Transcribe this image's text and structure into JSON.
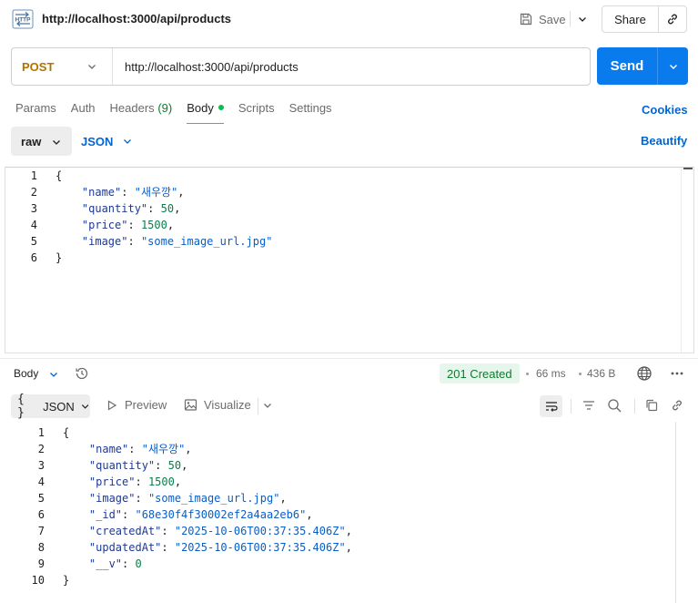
{
  "header": {
    "icon": "http-icon",
    "title": "http://localhost:3000/api/products",
    "save_label": "Save",
    "share_label": "Share"
  },
  "request": {
    "method": "POST",
    "url": "http://localhost:3000/api/products",
    "send_label": "Send"
  },
  "tabs": [
    {
      "label": "Params"
    },
    {
      "label": "Auth"
    },
    {
      "label": "Headers",
      "count": "(9)"
    },
    {
      "label": "Body",
      "active": true
    },
    {
      "label": "Scripts"
    },
    {
      "label": "Settings"
    }
  ],
  "cookies_label": "Cookies",
  "body_options": {
    "mode": "raw",
    "language": "JSON",
    "beautify_label": "Beautify"
  },
  "request_body": {
    "lines": [
      {
        "no": "1",
        "tokens": [
          [
            "p",
            "{"
          ]
        ]
      },
      {
        "no": "2",
        "tokens": [
          [
            "p",
            "    "
          ],
          [
            "k",
            "\"name\""
          ],
          [
            "p",
            ": "
          ],
          [
            "s",
            "\"새우깡\""
          ],
          [
            "p",
            ","
          ]
        ]
      },
      {
        "no": "3",
        "tokens": [
          [
            "p",
            "    "
          ],
          [
            "k",
            "\"quantity\""
          ],
          [
            "p",
            ": "
          ],
          [
            "n",
            "50"
          ],
          [
            "p",
            ","
          ]
        ]
      },
      {
        "no": "4",
        "tokens": [
          [
            "p",
            "    "
          ],
          [
            "k",
            "\"price\""
          ],
          [
            "p",
            ": "
          ],
          [
            "n",
            "1500"
          ],
          [
            "p",
            ","
          ]
        ]
      },
      {
        "no": "5",
        "tokens": [
          [
            "p",
            "    "
          ],
          [
            "k",
            "\"image\""
          ],
          [
            "p",
            ": "
          ],
          [
            "s",
            "\"some_image_url.jpg\""
          ]
        ]
      },
      {
        "no": "6",
        "tokens": [
          [
            "p",
            "}"
          ]
        ]
      }
    ]
  },
  "response": {
    "body_label": "Body",
    "status": "201 Created",
    "time": "66 ms",
    "size": "436 B",
    "format_label": "JSON",
    "preview_label": "Preview",
    "visualize_label": "Visualize",
    "status_color": "#0c7d2b",
    "lines": [
      {
        "no": "1",
        "tokens": [
          [
            "p",
            "{"
          ]
        ]
      },
      {
        "no": "2",
        "tokens": [
          [
            "p",
            "    "
          ],
          [
            "k",
            "\"name\""
          ],
          [
            "p",
            ": "
          ],
          [
            "s",
            "\"새우깡\""
          ],
          [
            "p",
            ","
          ]
        ]
      },
      {
        "no": "3",
        "tokens": [
          [
            "p",
            "    "
          ],
          [
            "k",
            "\"quantity\""
          ],
          [
            "p",
            ": "
          ],
          [
            "n",
            "50"
          ],
          [
            "p",
            ","
          ]
        ]
      },
      {
        "no": "4",
        "tokens": [
          [
            "p",
            "    "
          ],
          [
            "k",
            "\"price\""
          ],
          [
            "p",
            ": "
          ],
          [
            "n",
            "1500"
          ],
          [
            "p",
            ","
          ]
        ]
      },
      {
        "no": "5",
        "tokens": [
          [
            "p",
            "    "
          ],
          [
            "k",
            "\"image\""
          ],
          [
            "p",
            ": "
          ],
          [
            "s",
            "\"some_image_url.jpg\""
          ],
          [
            "p",
            ","
          ]
        ]
      },
      {
        "no": "6",
        "tokens": [
          [
            "p",
            "    "
          ],
          [
            "k",
            "\"_id\""
          ],
          [
            "p",
            ": "
          ],
          [
            "s",
            "\"68e30f4f30002ef2a4aa2eb6\""
          ],
          [
            "p",
            ","
          ]
        ]
      },
      {
        "no": "7",
        "tokens": [
          [
            "p",
            "    "
          ],
          [
            "k",
            "\"createdAt\""
          ],
          [
            "p",
            ": "
          ],
          [
            "s",
            "\"2025-10-06T00:37:35.406Z\""
          ],
          [
            "p",
            ","
          ]
        ]
      },
      {
        "no": "8",
        "tokens": [
          [
            "p",
            "    "
          ],
          [
            "k",
            "\"updatedAt\""
          ],
          [
            "p",
            ": "
          ],
          [
            "s",
            "\"2025-10-06T00:37:35.406Z\""
          ],
          [
            "p",
            ","
          ]
        ]
      },
      {
        "no": "9",
        "tokens": [
          [
            "p",
            "    "
          ],
          [
            "k",
            "\"__v\""
          ],
          [
            "p",
            ": "
          ],
          [
            "n",
            "0"
          ]
        ]
      },
      {
        "no": "10",
        "tokens": [
          [
            "p",
            "}"
          ]
        ]
      }
    ]
  },
  "colors": {
    "accent": "#097bed",
    "link": "#0265d2",
    "method": "#b07300",
    "active_tab_underline": "#f26b3a"
  }
}
